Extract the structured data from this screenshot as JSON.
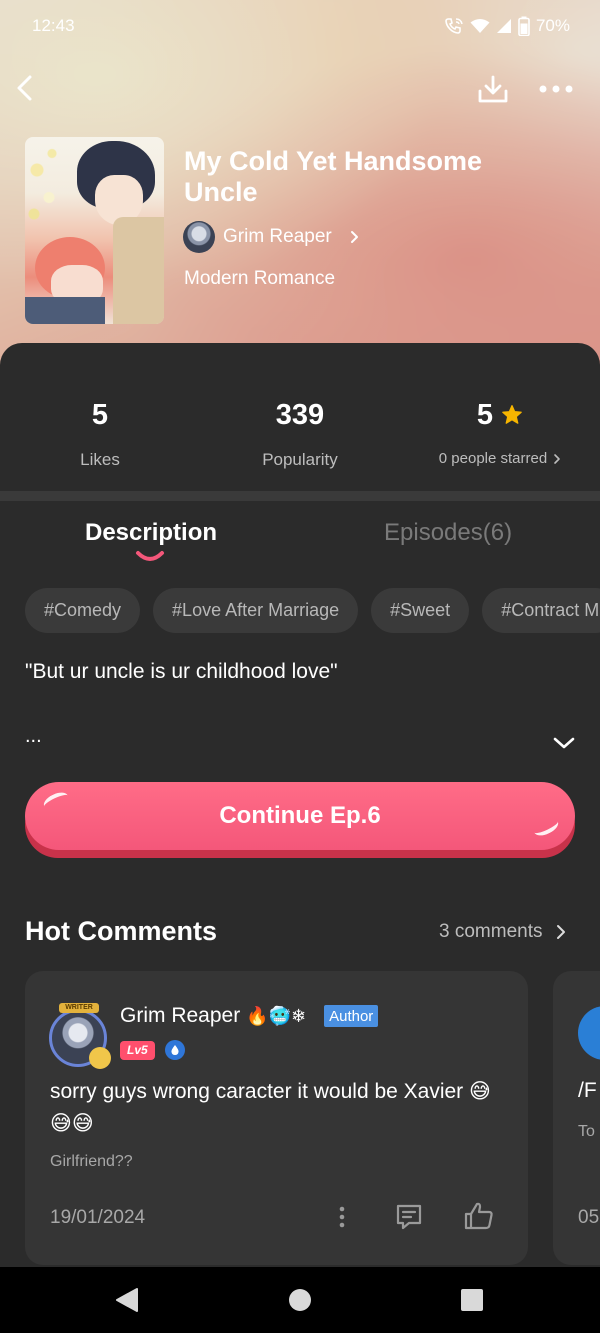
{
  "status_bar": {
    "time": "12:43",
    "battery": "70%",
    "icons": [
      "wifi-call-icon",
      "wifi-icon",
      "signal-icon",
      "battery-icon"
    ]
  },
  "top_bar": {
    "icons": [
      "back-arrow-icon",
      "download-icon",
      "more-dots-icon"
    ]
  },
  "comic": {
    "title": "My Cold Yet Handsome Uncle",
    "author": "Grim Reaper",
    "genre": "Modern Romance"
  },
  "stats": {
    "likes_value": "5",
    "likes_label": "Likes",
    "popularity_value": "339",
    "popularity_label": "Popularity",
    "rating_value": "5",
    "rating_label": "0 people starred"
  },
  "tabs": {
    "description": "Description",
    "episodes": "Episodes(6)"
  },
  "tags": [
    "#Comedy",
    "#Love After Marriage",
    "#Sweet",
    "#Contract M"
  ],
  "description": {
    "text": "\"But ur uncle is ur childhood love\"",
    "ellipsis": "..."
  },
  "cta": {
    "label": "Continue Ep.6"
  },
  "hot_comments": {
    "title": "Hot Comments",
    "count": "3 comments",
    "comments": [
      {
        "avatar_badge": "WRITER",
        "name": "Grim Reaper",
        "emojis": "🔥🥶❄",
        "author_badge": "Author",
        "level": "Lv5",
        "text": "sorry guys wrong caracter it would be Xavier 😅😅😅",
        "reply_preview": "Girlfriend??",
        "date": "19/01/2024"
      },
      {
        "text": "/F",
        "sub": "To",
        "date": "05"
      }
    ]
  },
  "colors": {
    "accent": "#f4577a",
    "card": "#2b2b2b",
    "star": "#f7b500",
    "author_badge": "#4a90e2"
  }
}
